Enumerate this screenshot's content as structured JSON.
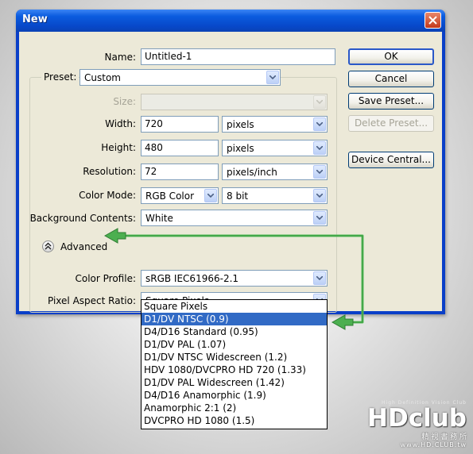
{
  "window": {
    "title": "New"
  },
  "form": {
    "name_label": "Name:",
    "name_value": "Untitled-1",
    "preset_label": "Preset:",
    "preset_value": "Custom",
    "size_label": "Size:",
    "size_value": "",
    "width_label": "Width:",
    "width_value": "720",
    "width_unit": "pixels",
    "height_label": "Height:",
    "height_value": "480",
    "height_unit": "pixels",
    "resolution_label": "Resolution:",
    "resolution_value": "72",
    "resolution_unit": "pixels/inch",
    "color_mode_label": "Color Mode:",
    "color_mode_value": "RGB Color",
    "bit_depth_value": "8 bit",
    "background_label": "Background Contents:",
    "background_value": "White",
    "advanced_label": "Advanced",
    "color_profile_label": "Color Profile:",
    "color_profile_value": "sRGB IEC61966-2.1",
    "pixel_aspect_label": "Pixel Aspect Ratio:",
    "pixel_aspect_value": "Square Pixels"
  },
  "buttons": {
    "ok": "OK",
    "cancel": "Cancel",
    "save_preset": "Save Preset...",
    "delete_preset": "Delete Preset...",
    "device_central": "Device Central..."
  },
  "pixel_aspect_options": [
    "Square Pixels",
    "D1/DV NTSC (0.9)",
    "D4/D16 Standard (0.95)",
    "D1/DV PAL (1.07)",
    "D1/DV NTSC Widescreen (1.2)",
    "HDV 1080/DVCPRO HD 720 (1.33)",
    "D1/DV PAL Widescreen (1.42)",
    "D4/D16 Anamorphic (1.9)",
    "Anamorphic 2:1 (2)",
    "DVCPRO HD 1080 (1.5)"
  ],
  "selected_option_index": 1,
  "watermark": {
    "tagline": "High Definition Vision Club",
    "logo": "HDclub",
    "chinese": "精 視 書 務 所",
    "url": "www.HD.CLUB.tw"
  },
  "colors": {
    "title_bar": "#0b5cdf",
    "dialog_bg": "#ece9d8",
    "selection": "#316ac5",
    "annotation_arrow": "#4caf50"
  },
  "icons": {
    "close": "close-icon",
    "dropdown": "chevron-down-icon",
    "advanced": "double-chevron-up-icon",
    "annotation": "green-arrow"
  }
}
